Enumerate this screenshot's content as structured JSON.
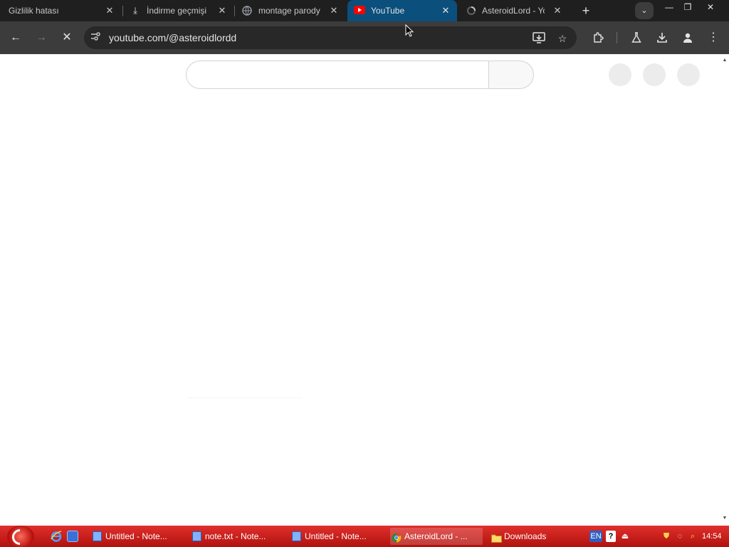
{
  "tabs": [
    {
      "title": "Gizlilik hatası",
      "icon": "none",
      "active": false
    },
    {
      "title": "İndirme geçmişi",
      "icon": "download-icon",
      "active": false
    },
    {
      "title": "montage parody",
      "icon": "globe-icon",
      "active": false
    },
    {
      "title": "YouTube",
      "icon": "youtube-icon",
      "active": true
    },
    {
      "title": "AsteroidLord - Yo",
      "icon": "loading-icon",
      "active": false
    }
  ],
  "omnibox": {
    "url": "youtube.com/@asteroidlordd"
  },
  "taskbar": {
    "items": [
      {
        "label": "Untitled - Note..."
      },
      {
        "label": "note.txt - Note..."
      },
      {
        "label": "Untitled - Note..."
      },
      {
        "label": "AsteroidLord - ..."
      },
      {
        "label": "Downloads"
      }
    ],
    "language": "EN",
    "clock": "14:54"
  },
  "colors": {
    "tabstrip_bg": "#1f1f1f",
    "active_tab_bg": "#0b4f7c",
    "toolbar_bg": "#3c3c3c",
    "omnibox_bg": "#282828",
    "taskbar_bg": "#c41a15"
  }
}
